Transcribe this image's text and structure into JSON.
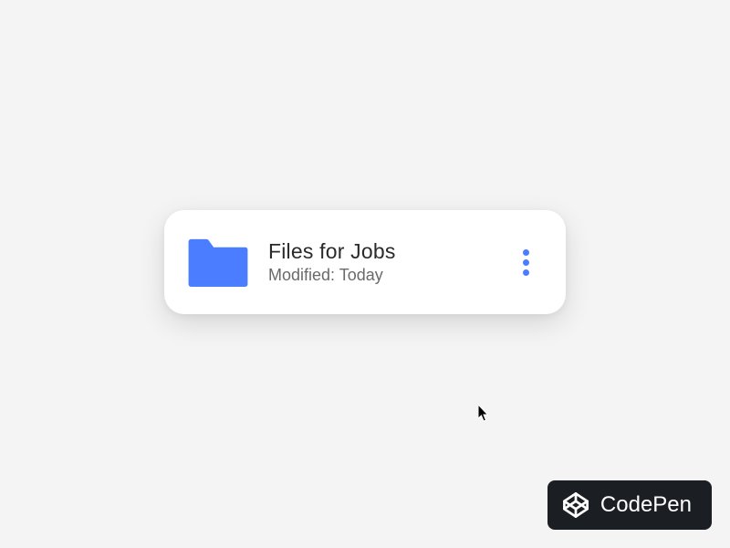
{
  "card": {
    "title": "Files for Jobs",
    "subtitle": "Modified: Today"
  },
  "badge": {
    "label": "CodePen"
  }
}
